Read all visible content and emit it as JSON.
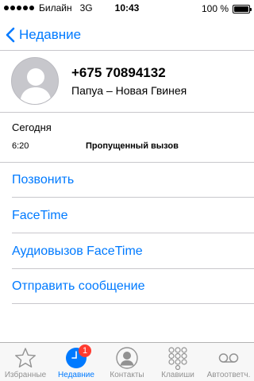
{
  "status_bar": {
    "carrier": "Билайн",
    "network": "3G",
    "time": "10:43",
    "battery_text": "100 %",
    "battery_level": 1.0,
    "signal_strength": 5
  },
  "nav": {
    "back_label": "Недавние"
  },
  "contact": {
    "phone": "+675 70894132",
    "location": "Папуа – Новая Гвинея"
  },
  "call_info": {
    "date": "Сегодня",
    "time": "6:20",
    "status": "Пропущенный вызов"
  },
  "actions": [
    {
      "label": "Позвонить"
    },
    {
      "label": "FaceTime"
    },
    {
      "label": "Аудиовызов FaceTime"
    },
    {
      "label": "Отправить сообщение"
    }
  ],
  "tabs": [
    {
      "label": "Избранные",
      "icon": "star-icon"
    },
    {
      "label": "Недавние",
      "icon": "clock-icon",
      "badge": "1",
      "active": true
    },
    {
      "label": "Контакты",
      "icon": "contacts-icon"
    },
    {
      "label": "Клавиши",
      "icon": "keypad-icon"
    },
    {
      "label": "Автоответч.",
      "icon": "voicemail-icon"
    }
  ],
  "colors": {
    "accent": "#007aff",
    "badge": "#ff3b30",
    "separator": "#c8c7cc",
    "tab_inactive": "#929292"
  }
}
